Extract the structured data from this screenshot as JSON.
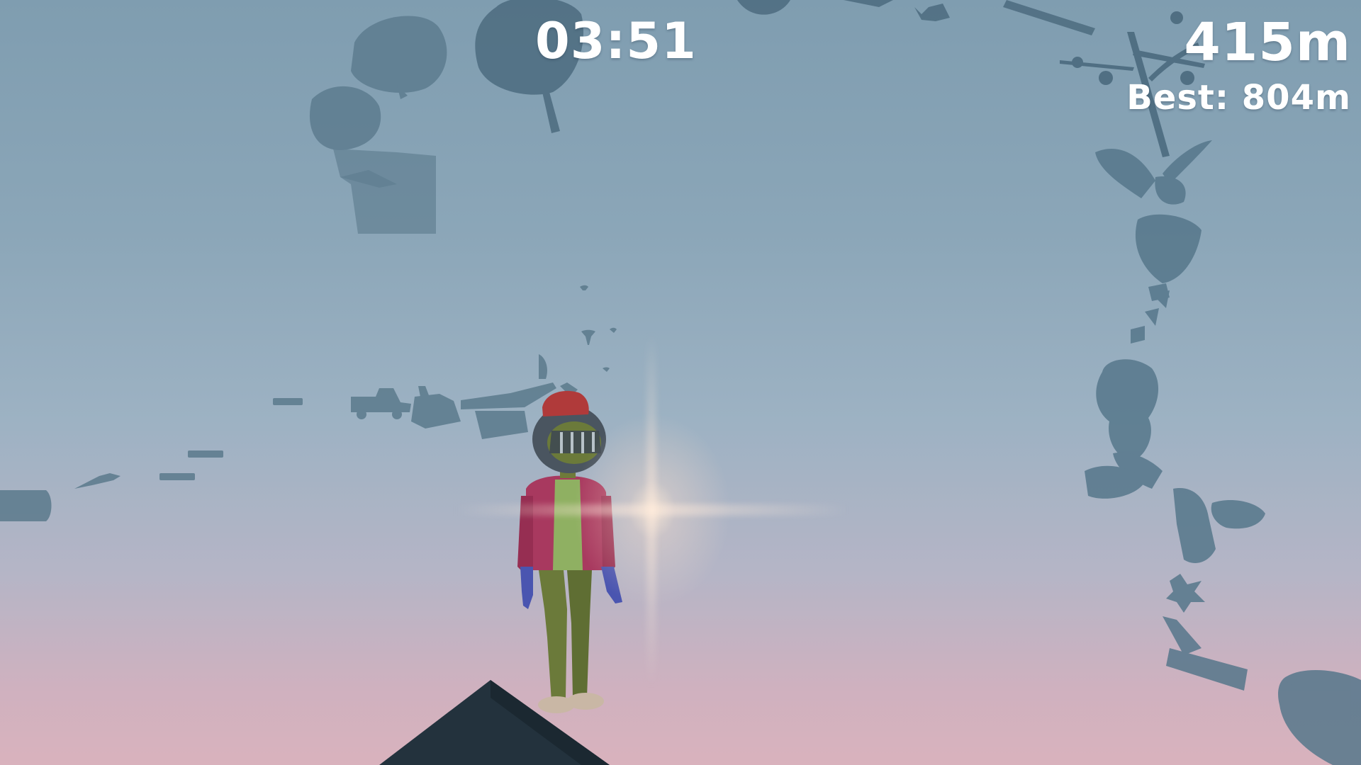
{
  "hud": {
    "timer": "03:51",
    "height": "415m",
    "best": "Best: 804m"
  },
  "colors": {
    "sky_top": "#7f9db0",
    "sky_bottom": "#d9b2bd",
    "silhouette": "#5f7d90",
    "hud_text": "#ffffff",
    "jacket": "#a8395f",
    "shirt": "#8fb062",
    "pants": "#6b7a3a",
    "helmet": "#4a5560",
    "beanie": "#b03a3a",
    "roof": "#23323d"
  }
}
